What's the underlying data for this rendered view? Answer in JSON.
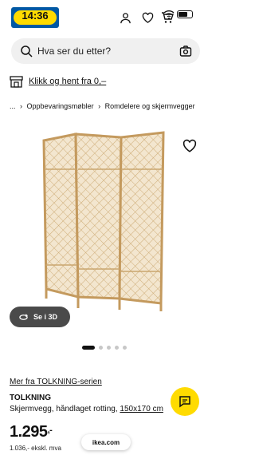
{
  "status": {
    "time": "14:36"
  },
  "header": {
    "icons": [
      "user-icon",
      "heart-icon",
      "cart-icon"
    ]
  },
  "search": {
    "placeholder": "Hva ser du etter?"
  },
  "collect": {
    "label": "Klikk og hent fra 0,–"
  },
  "breadcrumb": {
    "ellipsis": "...",
    "items": [
      "Oppbevaringsmøbler",
      "Romdelere og skjermvegger"
    ]
  },
  "product": {
    "view3d_label": "Se i 3D",
    "carousel_total": 5,
    "carousel_active": 1,
    "series_link": "Mer fra TOLKNING-serien",
    "name": "TOLKNING",
    "desc_main": "Skjermvegg, håndlaget rotting, ",
    "desc_dim": "150x170 cm",
    "price_main": "1.295",
    "price_suffix": ",-",
    "ex_vat": "1.036,- ekskl. mva"
  },
  "browser": {
    "url": "ikea.com"
  },
  "colors": {
    "brand_blue": "#0058a3",
    "brand_yellow": "#ffdb00"
  }
}
